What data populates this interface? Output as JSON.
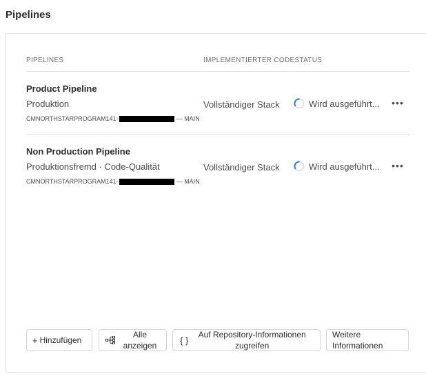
{
  "page": {
    "title": "Pipelines"
  },
  "table": {
    "col_pipelines": "PIPELINES",
    "col_status": "IMPLEMENTIERTER CODESTATUS"
  },
  "rows": [
    {
      "name": "Product Pipeline",
      "subtitle": "Produktion",
      "repo_prefix": "CMNORTHSTARPROGRAM141-",
      "repo_suffix": "— MAIN",
      "code_status": "Vollständiger Stack",
      "run_status": "Wird ausgeführt...",
      "more": "•••"
    },
    {
      "name": "Non Production Pipeline",
      "subtitle": "Produktionsfremd · Code-Qualität",
      "repo_prefix": "CMNORTHSTARPROGRAM141-",
      "repo_suffix": "— MAIN",
      "code_status": "Vollständiger Stack",
      "run_status": "Wird ausgeführt...",
      "more": "•••"
    }
  ],
  "actions": {
    "add_icon": "+",
    "add": "Hinzufügen",
    "view_all_icon": "pipeline-list-icon",
    "view_all_1": "Alle",
    "view_all_2": "anzeigen",
    "repo_icon": "{ }",
    "repo_1": "Auf Repository-Informationen",
    "repo_2": "zugreifen",
    "more_info_1": "Weitere",
    "more_info_2": "Informationen"
  },
  "colors": {
    "spinner": "#2680eb",
    "border": "#e1e1e1"
  }
}
